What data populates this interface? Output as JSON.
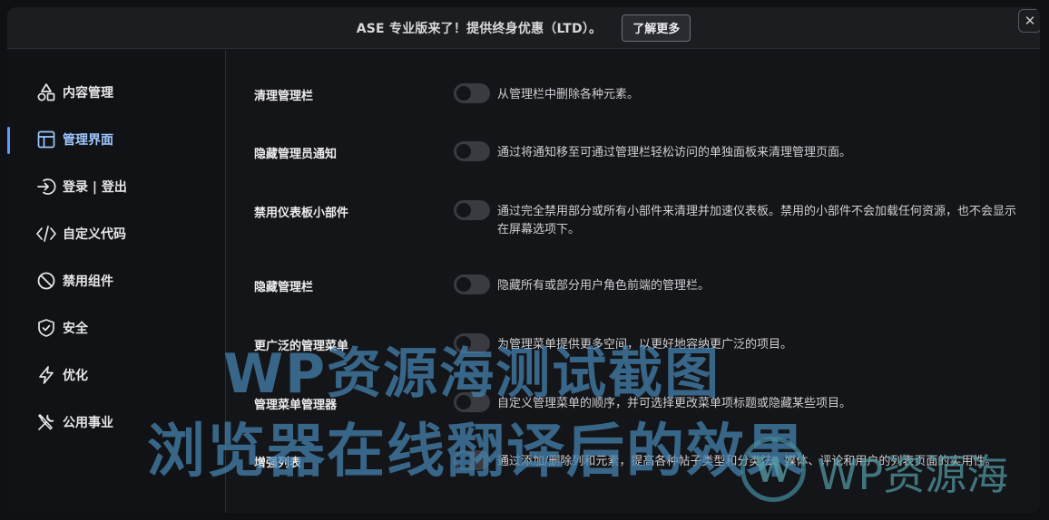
{
  "banner": {
    "text": "ASE 专业版来了！提供终身优惠（LTD）。",
    "button_label": "了解更多"
  },
  "close_glyph": "✕",
  "sidebar": {
    "items": [
      {
        "label": "内容管理",
        "icon": "shapes-icon"
      },
      {
        "label": "管理界面",
        "icon": "layout-icon"
      },
      {
        "label": "登录 | 登出",
        "icon": "login-icon"
      },
      {
        "label": "自定义代码",
        "icon": "code-icon"
      },
      {
        "label": "禁用组件",
        "icon": "ban-icon"
      },
      {
        "label": "安全",
        "icon": "shield-icon"
      },
      {
        "label": "优化",
        "icon": "bolt-icon"
      },
      {
        "label": "公用事业",
        "icon": "tools-icon"
      }
    ],
    "active_index": 1
  },
  "settings": [
    {
      "title": "清理管理栏",
      "description": "从管理栏中删除各种元素。",
      "enabled": false
    },
    {
      "title": "隐藏管理员通知",
      "description": "通过将通知移至可通过管理栏轻松访问的单独面板来清理管理页面。",
      "enabled": false
    },
    {
      "title": "禁用仪表板小部件",
      "description": "通过完全禁用部分或所有小部件来清理并加速仪表板。禁用的小部件不会加载任何资源，也不会显示在屏幕选项下。",
      "enabled": false
    },
    {
      "title": "隐藏管理栏",
      "description": "隐藏所有或部分用户角色前端的管理栏。",
      "enabled": false
    },
    {
      "title": "更广泛的管理菜单",
      "description": "为管理菜单提供更多空间，以更好地容纳更广泛的项目。",
      "enabled": false
    },
    {
      "title": "管理菜单管理器",
      "description": "自定义管理菜单的顺序，并可选择更改菜单项标题或隐藏某些项目。",
      "enabled": false
    },
    {
      "title": "增强列表",
      "description": "通过添加/删除列和元素，提高各种帖子类型和分类法、媒体、评论和用户的列表页面的实用性。",
      "enabled": false
    }
  ],
  "watermark": {
    "line1": "WP资源海测试截图",
    "line2": "浏览器在线翻译后的效果",
    "logo_letter": "W",
    "logo_text": "WP资源海"
  },
  "colors": {
    "accent": "#5b9dff",
    "background": "#141518",
    "toggle_off": "#3a3b40"
  }
}
